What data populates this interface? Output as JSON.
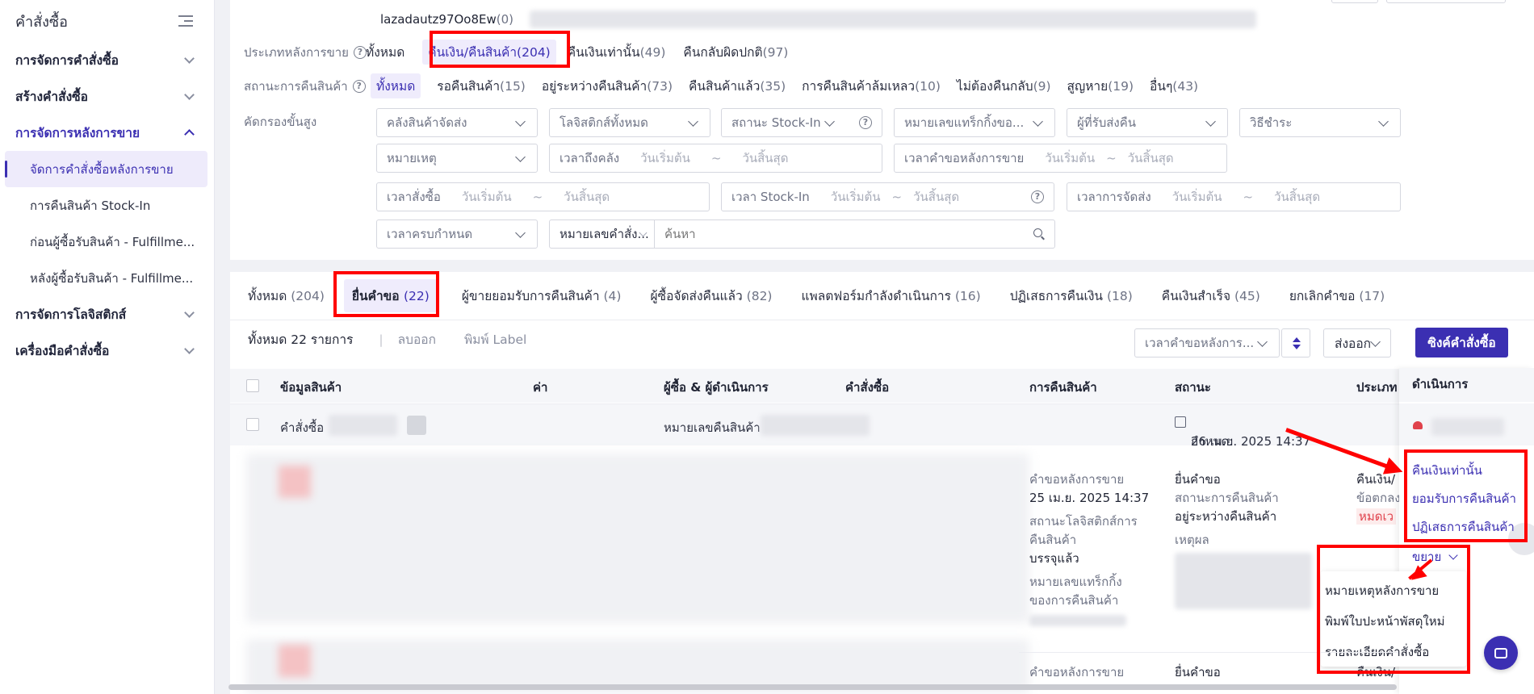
{
  "sidebar": {
    "title": "คำสั่งซื้อ",
    "groups": [
      {
        "label": "การจัดการคำสั่งซื้อ"
      },
      {
        "label": "สร้างคำสั่งซื้อ"
      },
      {
        "label": "การจัดการหลังการขาย"
      },
      {
        "label": "การจัดการโลจิสติกส์"
      },
      {
        "label": "เครื่องมือคำสั่งซื้อ"
      }
    ],
    "subitems": [
      {
        "label": "จัดการคำสั่งซื้อหลังการขาย"
      },
      {
        "label": "การคืนสินค้า Stock-In"
      },
      {
        "label": "ก่อนผู้ซื้อรับสินค้า - Fulfillme..."
      },
      {
        "label": "หลังผู้ซื้อรับสินค้า - Fulfillme..."
      }
    ]
  },
  "account": {
    "name": "lazadautz97Oo8Ew",
    "count": "(0)"
  },
  "aftersale_type": {
    "label": "ประเภทหลังการขาย",
    "options": [
      {
        "label": "ทั้งหมด",
        "count": ""
      },
      {
        "label": "คืนเงิน/คืนสินค้า",
        "count": "(204)"
      },
      {
        "label": "คืนเงินเท่านั้น",
        "count": "(49)"
      },
      {
        "label": "คืนกลับผิดปกติ",
        "count": "(97)"
      }
    ]
  },
  "return_status": {
    "label": "สถานะการคืนสินค้า",
    "options": [
      {
        "label": "ทั้งหมด",
        "count": ""
      },
      {
        "label": "รอคืนสินค้า",
        "count": "(15)"
      },
      {
        "label": "อยู่ระหว่างคืนสินค้า",
        "count": "(73)"
      },
      {
        "label": "คืนสินค้าแล้ว",
        "count": "(35)"
      },
      {
        "label": "การคืนสินค้าล้มเหลว",
        "count": "(10)"
      },
      {
        "label": "ไม่ต้องคืนกลับ",
        "count": "(9)"
      },
      {
        "label": "สูญหาย",
        "count": "(19)"
      },
      {
        "label": "อื่นๆ",
        "count": "(43)"
      }
    ]
  },
  "advanced": {
    "label": "คัดกรองขั้นสูง",
    "warehouse": "คลังสินค้าจัดส่ง",
    "logistics": "โลจิสติกส์ทั้งหมด",
    "stockin_status": "สถานะ Stock-In",
    "tracking": "หมายเลขแทร็กกิ้งขอ...",
    "receiver": "ผู้ที่รับส่งคืน",
    "payment": "วิธีชำระ",
    "note": "หมายเหตุ",
    "arrival_time": "เวลาถึงคลัง",
    "request_time": "เวลาคำขอหลังการขาย",
    "order_time": "เวลาสั่งซื้อ",
    "stockin_time": "เวลา Stock-In",
    "ship_time": "เวลาการจัดส่ง",
    "due_time": "เวลาครบกำหนด",
    "order_no": "หมายเลขคำสั่ง...",
    "search_placeholder": "ค้นหา",
    "start": "วันเริ่มต้น",
    "end": "วันสิ้นสุด",
    "tilde": "~"
  },
  "tabs": [
    {
      "label": "ทั้งหมด",
      "count": "(204)"
    },
    {
      "label": "ยื่นคำขอ",
      "count": "(22)"
    },
    {
      "label": "ผู้ขายยอมรับการคืนสินค้า",
      "count": "(4)"
    },
    {
      "label": "ผู้ซื้อจัดส่งคืนแล้ว",
      "count": "(82)"
    },
    {
      "label": "แพลตฟอร์มกำลังดำเนินการ",
      "count": "(16)"
    },
    {
      "label": "ปฏิเสธการคืนเงิน",
      "count": "(18)"
    },
    {
      "label": "คืนเงินสำเร็จ",
      "count": "(45)"
    },
    {
      "label": "ยกเลิกคำขอ",
      "count": "(17)"
    }
  ],
  "toolbar": {
    "total": "ทั้งหมด 22 รายการ",
    "remove": "ลบออก",
    "print_label": "พิมพ์ Label",
    "sort_by": "เวลาคำขอหลังการ...",
    "export": "ส่งออก",
    "sync": "ซิงค์คำสั่งซื้อ"
  },
  "table": {
    "headers": [
      "ข้อมูลสินค้า",
      "ค่า",
      "ผู้ซื้อ & ผู้ดำเนินการ",
      "คำสั่งซื้อ",
      "การคืนสินค้า",
      "สถานะ",
      "ประเภท",
      "ดำเนินการ"
    ],
    "order_label": "คำสั่งซื้อ",
    "return_no_label": "หมายเลขคืนสินค้า",
    "due_label": "กำหนด:",
    "due_value": "26 เม.ย. 2025 14:37"
  },
  "row1": {
    "req_label": "คำขอหลังการขาย",
    "req_time": "25 เม.ย. 2025 14:37",
    "log_label1": "สถานะโลจิสติกส์การ",
    "log_label2": "คืนสินค้า",
    "log_value": "บรรจุแล้ว",
    "trk_label1": "หมายเลขแทร็กกิ้ง",
    "trk_label2": "ของการคืนสินค้า",
    "status": "ยื่นคำขอ",
    "ret_status_label": "สถานะการคืนสินค้า",
    "ret_status": "อยู่ระหว่างคืนสินค้า",
    "reason_label": "เหตุผล",
    "type": "คืนเงิน/",
    "type_sub": "ข้อตกลง",
    "timeout": "หมดเว",
    "act1": "คืนเงินเท่านั้น",
    "act2": "ยอมรับการคืนสินค้า",
    "act3": "ปฏิเสธการคืนสินค้า",
    "expand": "ขยาย"
  },
  "menu": [
    "หมายเหตุหลังการขาย",
    "พิมพ์ใบปะหน้าพัสดุใหม่",
    "รายละเอียดคำสั่งซื้อ"
  ],
  "row2": {
    "req_label": "คำขอหลังการขาย",
    "status": "ยื่นคำขอ",
    "type": "คืนเงิน/"
  },
  "colors": {
    "accent": "#3b2fb2",
    "highlight": "#ff0000",
    "error": "#e0424c"
  }
}
